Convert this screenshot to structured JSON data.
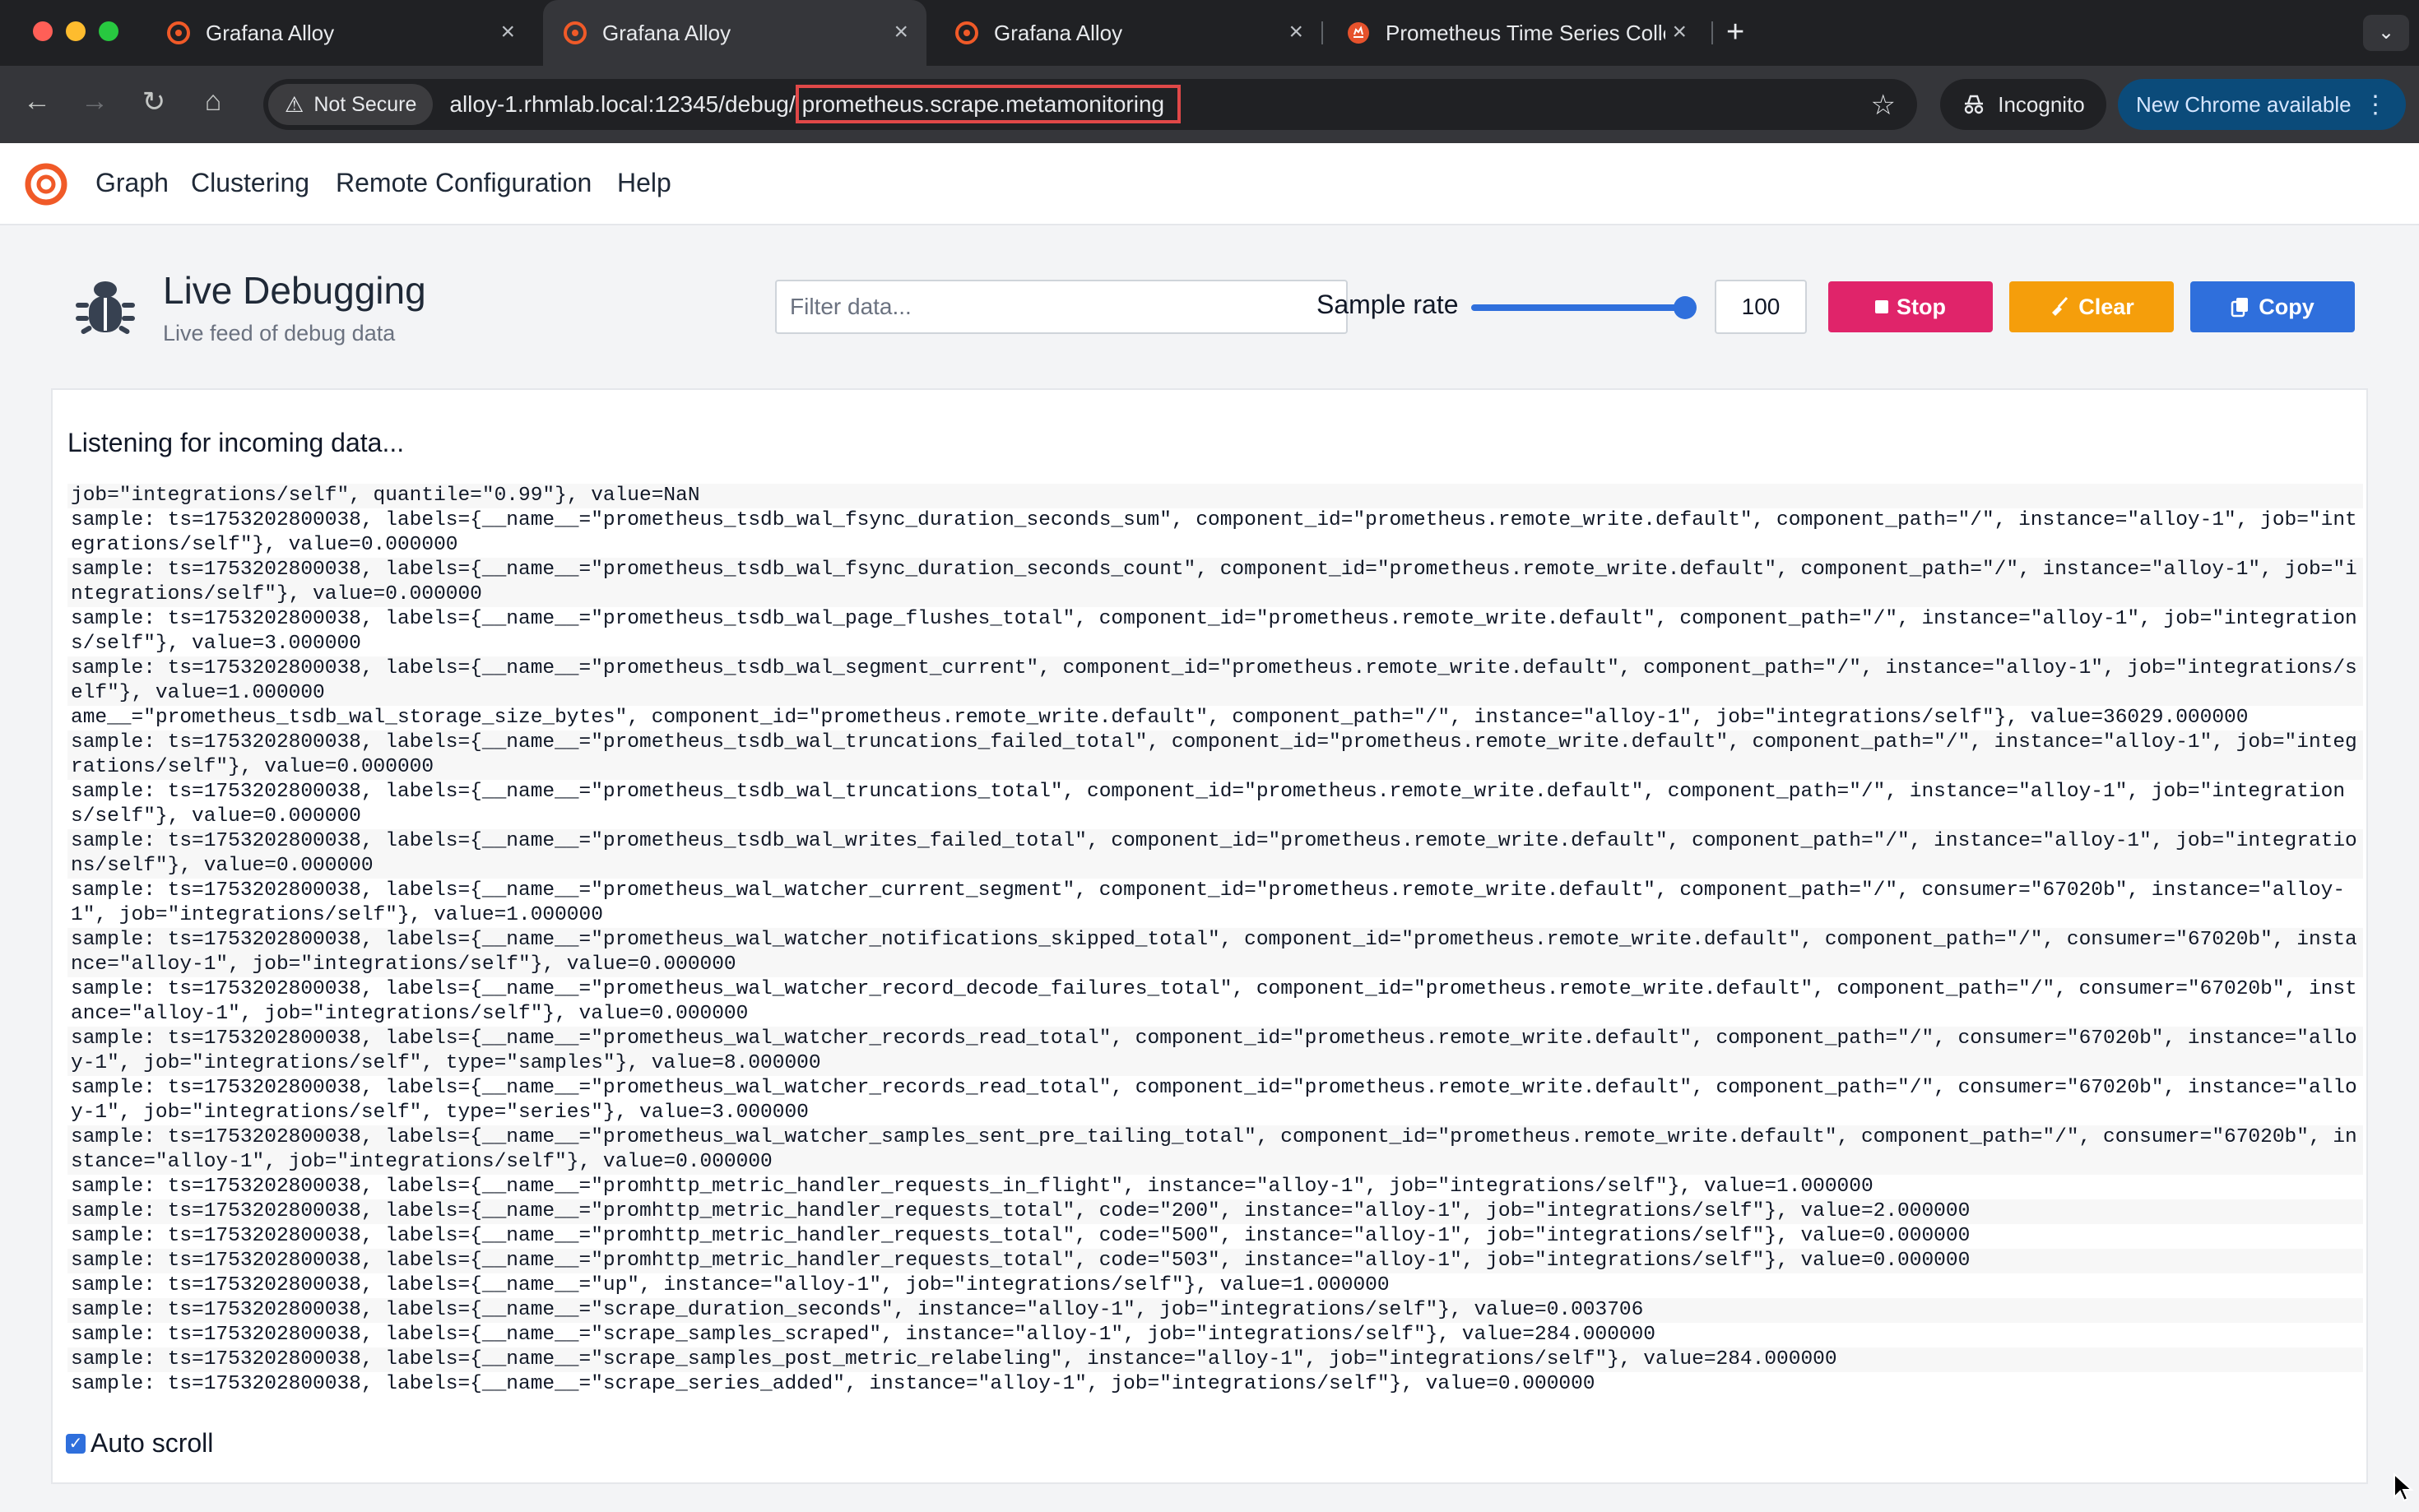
{
  "browser": {
    "tabs": [
      {
        "title": "Grafana Alloy",
        "active": false
      },
      {
        "title": "Grafana Alloy",
        "active": true
      },
      {
        "title": "Grafana Alloy",
        "active": false
      },
      {
        "title": "Prometheus Time Series Colle",
        "active": false
      }
    ],
    "new_tab_glyph": "+",
    "security_label": "Not Secure",
    "url_prefix": "alloy-1.rhmlab.local:12345/debug/",
    "url_highlight": "prometheus.scrape.metamonitoring",
    "incognito_label": "Incognito",
    "update_label": "New Chrome available"
  },
  "nav": {
    "items": [
      "Graph",
      "Clustering",
      "Remote Configuration",
      "Help"
    ]
  },
  "header": {
    "title": "Live Debugging",
    "subtitle": "Live feed of debug data",
    "filter_placeholder": "Filter data...",
    "sample_rate_label": "Sample rate",
    "sample_rate_value": "100",
    "sample_rate_slider_fraction": 1.0,
    "buttons": {
      "stop": "Stop",
      "clear": "Clear",
      "copy": "Copy"
    }
  },
  "colors": {
    "stop": "#e0246a",
    "clear": "#f59e0b",
    "copy": "#2f6fdc",
    "accent": "#2f6fdc",
    "grafana_orange": "#f05a28"
  },
  "panel": {
    "status": "Listening for incoming data...",
    "auto_scroll_label": "Auto scroll",
    "auto_scroll_checked": true,
    "lines": [
      "job=\"integrations/self\", quantile=\"0.99\"}, value=NaN",
      "sample: ts=1753202800038, labels={__name__=\"prometheus_tsdb_wal_fsync_duration_seconds_sum\", component_id=\"prometheus.remote_write.default\", component_path=\"/\", instance=\"alloy-1\", job=\"integrations/self\"}, value=0.000000",
      "sample: ts=1753202800038, labels={__name__=\"prometheus_tsdb_wal_fsync_duration_seconds_count\", component_id=\"prometheus.remote_write.default\", component_path=\"/\", instance=\"alloy-1\", job=\"integrations/self\"}, value=0.000000",
      "sample: ts=1753202800038, labels={__name__=\"prometheus_tsdb_wal_page_flushes_total\", component_id=\"prometheus.remote_write.default\", component_path=\"/\", instance=\"alloy-1\", job=\"integrations/self\"}, value=3.000000",
      "sample: ts=1753202800038, labels={__name__=\"prometheus_tsdb_wal_segment_current\", component_id=\"prometheus.remote_write.default\", component_path=\"/\", instance=\"alloy-1\", job=\"integrations/self\"}, value=1.000000",
      "ame__=\"prometheus_tsdb_wal_storage_size_bytes\", component_id=\"prometheus.remote_write.default\", component_path=\"/\", instance=\"alloy-1\", job=\"integrations/self\"}, value=36029.000000",
      "sample: ts=1753202800038, labels={__name__=\"prometheus_tsdb_wal_truncations_failed_total\", component_id=\"prometheus.remote_write.default\", component_path=\"/\", instance=\"alloy-1\", job=\"integrations/self\"}, value=0.000000",
      "sample: ts=1753202800038, labels={__name__=\"prometheus_tsdb_wal_truncations_total\", component_id=\"prometheus.remote_write.default\", component_path=\"/\", instance=\"alloy-1\", job=\"integrations/self\"}, value=0.000000",
      "sample: ts=1753202800038, labels={__name__=\"prometheus_tsdb_wal_writes_failed_total\", component_id=\"prometheus.remote_write.default\", component_path=\"/\", instance=\"alloy-1\", job=\"integrations/self\"}, value=0.000000",
      "sample: ts=1753202800038, labels={__name__=\"prometheus_wal_watcher_current_segment\", component_id=\"prometheus.remote_write.default\", component_path=\"/\", consumer=\"67020b\", instance=\"alloy-1\", job=\"integrations/self\"}, value=1.000000",
      "sample: ts=1753202800038, labels={__name__=\"prometheus_wal_watcher_notifications_skipped_total\", component_id=\"prometheus.remote_write.default\", component_path=\"/\", consumer=\"67020b\", instance=\"alloy-1\", job=\"integrations/self\"}, value=0.000000",
      "sample: ts=1753202800038, labels={__name__=\"prometheus_wal_watcher_record_decode_failures_total\", component_id=\"prometheus.remote_write.default\", component_path=\"/\", consumer=\"67020b\", instance=\"alloy-1\", job=\"integrations/self\"}, value=0.000000",
      "sample: ts=1753202800038, labels={__name__=\"prometheus_wal_watcher_records_read_total\", component_id=\"prometheus.remote_write.default\", component_path=\"/\", consumer=\"67020b\", instance=\"alloy-1\", job=\"integrations/self\", type=\"samples\"}, value=8.000000",
      "sample: ts=1753202800038, labels={__name__=\"prometheus_wal_watcher_records_read_total\", component_id=\"prometheus.remote_write.default\", component_path=\"/\", consumer=\"67020b\", instance=\"alloy-1\", job=\"integrations/self\", type=\"series\"}, value=3.000000",
      "sample: ts=1753202800038, labels={__name__=\"prometheus_wal_watcher_samples_sent_pre_tailing_total\", component_id=\"prometheus.remote_write.default\", component_path=\"/\", consumer=\"67020b\", instance=\"alloy-1\", job=\"integrations/self\"}, value=0.000000",
      "sample: ts=1753202800038, labels={__name__=\"promhttp_metric_handler_requests_in_flight\", instance=\"alloy-1\", job=\"integrations/self\"}, value=1.000000",
      "sample: ts=1753202800038, labels={__name__=\"promhttp_metric_handler_requests_total\", code=\"200\", instance=\"alloy-1\", job=\"integrations/self\"}, value=2.000000",
      "sample: ts=1753202800038, labels={__name__=\"promhttp_metric_handler_requests_total\", code=\"500\", instance=\"alloy-1\", job=\"integrations/self\"}, value=0.000000",
      "sample: ts=1753202800038, labels={__name__=\"promhttp_metric_handler_requests_total\", code=\"503\", instance=\"alloy-1\", job=\"integrations/self\"}, value=0.000000",
      "sample: ts=1753202800038, labels={__name__=\"up\", instance=\"alloy-1\", job=\"integrations/self\"}, value=1.000000",
      "sample: ts=1753202800038, labels={__name__=\"scrape_duration_seconds\", instance=\"alloy-1\", job=\"integrations/self\"}, value=0.003706",
      "sample: ts=1753202800038, labels={__name__=\"scrape_samples_scraped\", instance=\"alloy-1\", job=\"integrations/self\"}, value=284.000000",
      "sample: ts=1753202800038, labels={__name__=\"scrape_samples_post_metric_relabeling\", instance=\"alloy-1\", job=\"integrations/self\"}, value=284.000000",
      "sample: ts=1753202800038, labels={__name__=\"scrape_series_added\", instance=\"alloy-1\", job=\"integrations/self\"}, value=0.000000"
    ]
  }
}
